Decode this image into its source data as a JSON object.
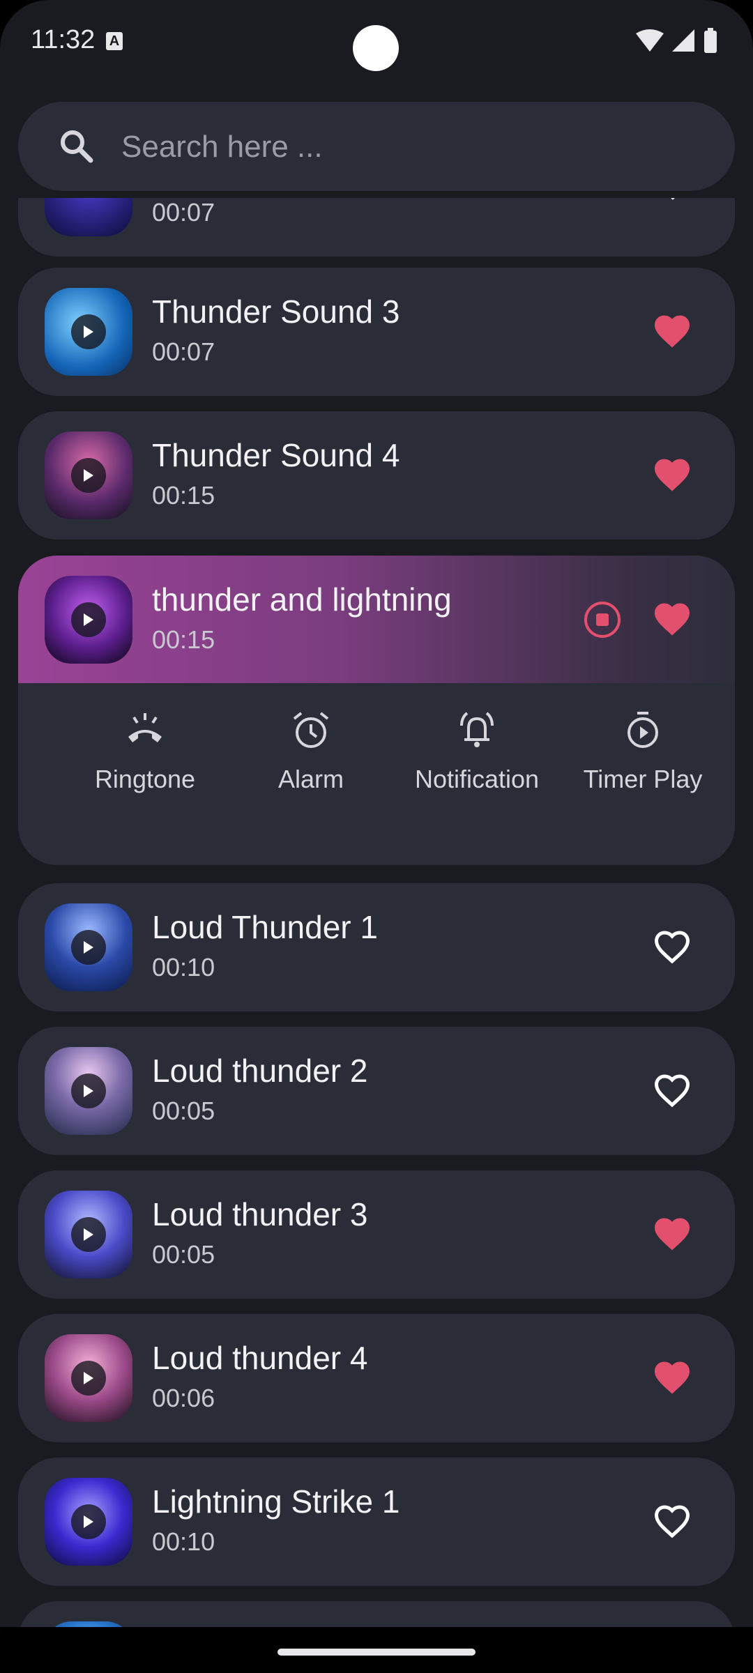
{
  "status": {
    "time": "11:32",
    "a_icon": "A"
  },
  "search": {
    "placeholder": "Search here ..."
  },
  "partial_top": {
    "duration": "00:07"
  },
  "sounds": [
    {
      "title": "Thunder Sound 3",
      "duration": "00:07",
      "favorite": true
    },
    {
      "title": "Thunder Sound 4",
      "duration": "00:15",
      "favorite": true
    },
    {
      "title": "thunder and lightning",
      "duration": "00:15",
      "favorite": true,
      "playing": true
    },
    {
      "title": "Loud Thunder 1",
      "duration": "00:10",
      "favorite": false
    },
    {
      "title": "Loud thunder 2",
      "duration": "00:05",
      "favorite": false
    },
    {
      "title": "Loud thunder 3",
      "duration": "00:05",
      "favorite": true
    },
    {
      "title": "Loud thunder 4",
      "duration": "00:06",
      "favorite": true
    },
    {
      "title": "Lightning Strike 1",
      "duration": "00:10",
      "favorite": false
    }
  ],
  "actions": [
    {
      "label": "Ringtone",
      "icon": "ringtone-icon"
    },
    {
      "label": "Alarm",
      "icon": "alarm-icon"
    },
    {
      "label": "Notification",
      "icon": "notification-icon"
    },
    {
      "label": "Timer Play",
      "icon": "timer-icon"
    }
  ],
  "colors": {
    "heart_active": "#e3506e",
    "card_bg": "#2a2c37",
    "page_bg": "#1a1b21"
  }
}
